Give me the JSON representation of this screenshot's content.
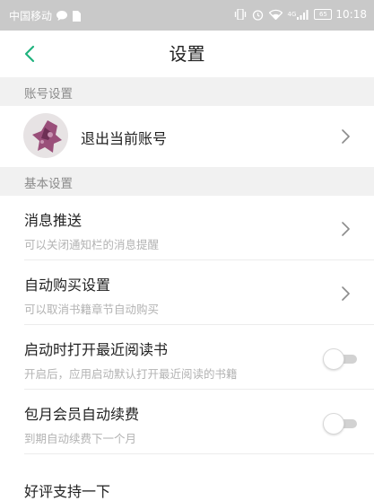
{
  "status_bar": {
    "carrier": "中国移动",
    "signal_text": "4G",
    "battery": "65",
    "time": "10:18"
  },
  "nav": {
    "title": "设置",
    "accent_color": "#1fb37e"
  },
  "account_section": {
    "header": "账号设置",
    "logout_label": "退出当前账号"
  },
  "basic_section": {
    "header": "基本设置",
    "items": [
      {
        "title": "消息推送",
        "subtitle": "可以关闭通知栏的消息提醒",
        "control": "chevron-right-icon"
      },
      {
        "title": "自动购买设置",
        "subtitle": "可以取消书籍章节自动购买",
        "control": "chevron-right-icon"
      },
      {
        "title": "启动时打开最近阅读书",
        "subtitle": "开启后，应用启动默认打开最近阅读的书籍",
        "control": "toggle",
        "enabled": false
      },
      {
        "title": "包月会员自动续费",
        "subtitle": "到期自动续费下一个月",
        "control": "toggle",
        "enabled": false
      },
      {
        "title": "好评支持一下"
      }
    ]
  }
}
